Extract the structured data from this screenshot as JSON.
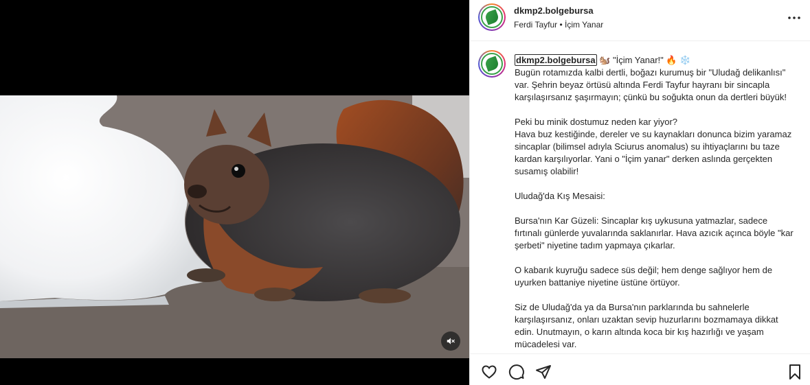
{
  "post": {
    "username": "dkmp2.bolgebursa",
    "audio": "Ferdi Tayfur • İçim Yanar",
    "caption_title": " 🐿️ \"İçim Yanar!\" 🔥 ❄️",
    "caption_body": "Bugün rotamızda kalbi dertli, boğazı kurumuş bir \"Uludağ delikanlısı\" var. Şehrin beyaz örtüsü altında Ferdi Tayfur hayranı bir sincapla karşılaşırsanız şaşırmayın; çünkü bu soğukta onun da dertleri büyük!\n\nPeki bu minik dostumuz neden kar yiyor?\nHava buz kestiğinde, dereler ve su kaynakları donunca bizim yaramaz sincaplar (bilimsel adıyla Sciurus anomalus) su ihtiyaçlarını bu taze kardan karşılıyorlar. Yani o \"İçim yanar\" derken aslında gerçekten susamış olabilir!\n\nUludağ'da Kış Mesaisi:\n\nBursa'nın Kar Güzeli: Sincaplar kış uykusuna yatmazlar, sadece fırtınalı günlerde yuvalarında saklanırlar. Hava azıcık açınca böyle \"kar şerbeti\" niyetine tadım yapmaya çıkarlar.\n\nO kabarık kuyruğu sadece süs değil; hem denge sağlıyor hem de uyurken battaniye niyetine üstüne örtüyor.\n\nSiz de Uludağ'da ya da Bursa'nın parklarında bu sahnelerle karşılaşırsanız, onları uzaktan sevip huzurlarını bozmamaya dikkat edin. Unutmayın, o karın altında koca bir kış hazırlığı ve yaşam mücadelesi var."
  },
  "icons": {
    "mute": "speaker-muted-icon",
    "more": "more-horizontal-icon",
    "like": "heart-icon",
    "comment": "comment-icon",
    "share": "paper-plane-icon",
    "save": "bookmark-icon"
  },
  "colors": {
    "text": "#262626",
    "border": "#efefef",
    "logo_green": "#3aa24a"
  }
}
